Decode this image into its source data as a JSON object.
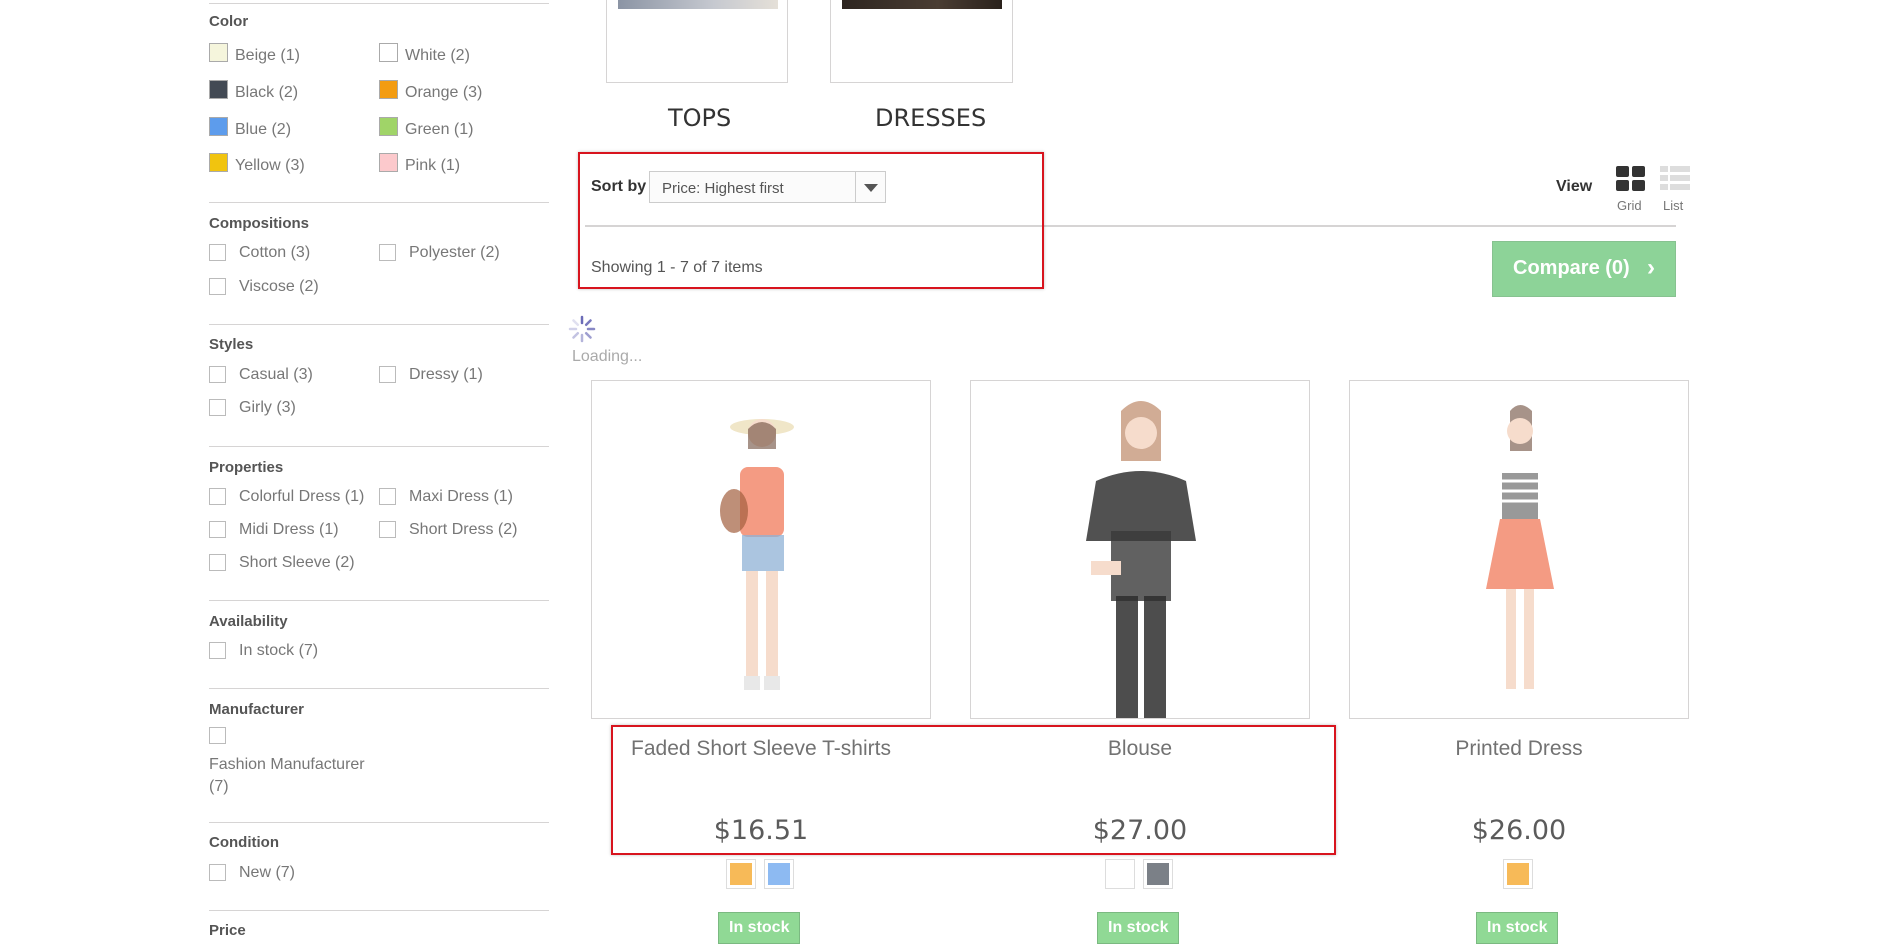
{
  "filters": {
    "color": {
      "title": "Color",
      "items": [
        {
          "label": "Beige (1)",
          "color": "#f5f5dc"
        },
        {
          "label": "White (2)",
          "color": "#ffffff"
        },
        {
          "label": "Black (2)",
          "color": "#434a54"
        },
        {
          "label": "Orange (3)",
          "color": "#f39c11"
        },
        {
          "label": "Blue (2)",
          "color": "#5d9cec"
        },
        {
          "label": "Green (1)",
          "color": "#a0d468"
        },
        {
          "label": "Yellow (3)",
          "color": "#f1c40f"
        },
        {
          "label": "Pink (1)",
          "color": "#fcc9cc"
        }
      ]
    },
    "compositions": {
      "title": "Compositions",
      "items": [
        "Cotton (3)",
        "Polyester (2)",
        "Viscose (2)"
      ]
    },
    "styles": {
      "title": "Styles",
      "items": [
        "Casual (3)",
        "Dressy (1)",
        "Girly (3)"
      ]
    },
    "properties": {
      "title": "Properties",
      "items": [
        "Colorful Dress (1)",
        "Maxi Dress (1)",
        "Midi Dress (1)",
        "Short Dress (2)",
        "Short Sleeve (2)"
      ]
    },
    "availability": {
      "title": "Availability",
      "items": [
        "In stock (7)"
      ]
    },
    "manufacturer": {
      "title": "Manufacturer",
      "items": [
        "Fashion Manufacturer (7)"
      ]
    },
    "condition": {
      "title": "Condition",
      "items": [
        "New (7)"
      ]
    },
    "price": {
      "title": "Price"
    }
  },
  "categories": [
    {
      "name": "TOPS"
    },
    {
      "name": "DRESSES"
    }
  ],
  "sort": {
    "label": "Sort by",
    "value": "Price: Highest first"
  },
  "view": {
    "label": "View",
    "grid": "Grid",
    "list": "List"
  },
  "showing": "Showing 1 - 7 of 7 items",
  "compare": {
    "label": "Compare (0)"
  },
  "loading": "Loading...",
  "products": [
    {
      "name": "Faded Short Sleeve T-shirts",
      "price": "$16.51",
      "swatches": [
        "#f39c11",
        "#5d9cec"
      ],
      "stock": "In stock"
    },
    {
      "name": "Blouse",
      "price": "$27.00",
      "swatches": [
        "#ffffff",
        "#434a54"
      ],
      "stock": "In stock"
    },
    {
      "name": "Printed Dress",
      "price": "$26.00",
      "swatches": [
        "#f39c11"
      ],
      "stock": "In stock"
    }
  ]
}
